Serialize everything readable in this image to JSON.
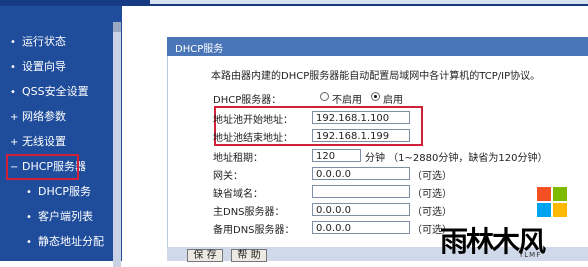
{
  "sidebar": {
    "items": [
      {
        "label": "运行状态",
        "bullet": "•"
      },
      {
        "label": "设置向导",
        "bullet": "•"
      },
      {
        "label": "QSS安全设置",
        "bullet": "•"
      },
      {
        "label": "网络参数",
        "bullet": "+"
      },
      {
        "label": "无线设置",
        "bullet": "+"
      },
      {
        "label": "DHCP服务器",
        "bullet": "−"
      },
      {
        "label": "DHCP服务",
        "bullet": "•"
      },
      {
        "label": "客户端列表",
        "bullet": "•"
      },
      {
        "label": "静态地址分配",
        "bullet": "•"
      }
    ]
  },
  "panel": {
    "title": "DHCP服务",
    "description": "本路由器内建的DHCP服务器能自动配置局域网中各计算机的TCP/IP协议。"
  },
  "form": {
    "dhcp_label": "DHCP服务器：",
    "disable_label": "不启用",
    "enable_label": "启用",
    "dhcp_enabled": true,
    "start_label": "地址池开始地址：",
    "start_value": "192.168.1.100",
    "end_label": "地址池结束地址：",
    "end_value": "192.168.1.199",
    "lease_label": "地址租期：",
    "lease_value": "120",
    "lease_unit": "分钟 （1~2880分钟，缺省为120分钟）",
    "gateway_label": "网关：",
    "gateway_value": "0.0.0.0",
    "domain_label": "缺省域名：",
    "domain_value": "",
    "dns1_label": "主DNS服务器：",
    "dns1_value": "0.0.0.0",
    "dns2_label": "备用DNS服务器：",
    "dns2_value": "0.0.0.0",
    "optional": "（可选）"
  },
  "buttons": {
    "save": "保 存",
    "help": "帮 助"
  },
  "watermark": {
    "logo_text": "雨林木风",
    "logo_sub": "YLMF",
    "colors": [
      "#f25022",
      "#7fba00",
      "#00a4ef",
      "#ffb900"
    ]
  },
  "colors": {
    "sidebar_bg": "#1f4d9c",
    "panel_header": "#4a76b8",
    "highlight": "#d0203a"
  }
}
